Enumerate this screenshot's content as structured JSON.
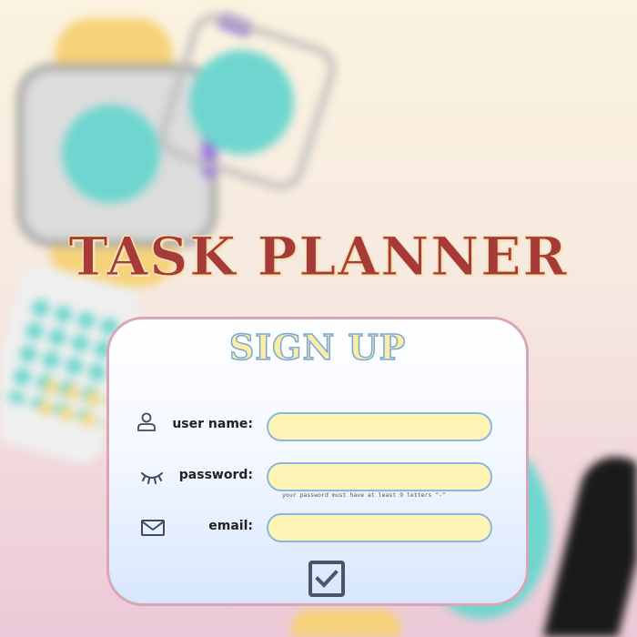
{
  "app": {
    "title": "TASK PLANNER"
  },
  "form": {
    "title": "SIGN UP",
    "fields": [
      {
        "label": "user name:",
        "icon": "user-icon",
        "value": ""
      },
      {
        "label": "password:",
        "icon": "closed-eye-icon",
        "value": ""
      },
      {
        "label": "email:",
        "icon": "mail-icon",
        "value": ""
      }
    ],
    "password_hint": "your password must have at least 9 letters ^-^",
    "submit_icon": "checkbox-check-icon"
  },
  "colors": {
    "title": "#a63a38",
    "card_title_fill": "#fbeca6",
    "card_title_stroke": "#78a7d8",
    "input_fill": "#fdf4b5",
    "input_border": "#8bb7df",
    "card_border": "#d9a6b5"
  }
}
